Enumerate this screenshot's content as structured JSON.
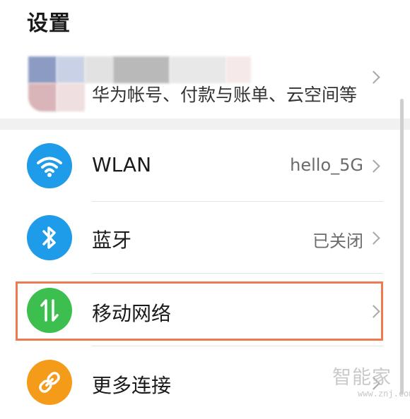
{
  "header": {
    "title": "设置"
  },
  "account": {
    "subtitle": "华为帐号、付款与账单、云空间等"
  },
  "settings": [
    {
      "label": "WLAN",
      "value": "hello_5G",
      "icon": "wifi-icon",
      "color": "#1e9be9"
    },
    {
      "label": "蓝牙",
      "value": "已关闭",
      "icon": "bluetooth-icon",
      "color": "#1e9be9"
    },
    {
      "label": "移动网络",
      "value": "",
      "icon": "mobile-data-icon",
      "color": "#3cbf4f"
    },
    {
      "label": "更多连接",
      "value": "",
      "icon": "link-icon",
      "color": "#f59b1a"
    }
  ],
  "highlight_color": "#ee7a52",
  "watermark": {
    "text": "智能家",
    "url": "www.znj.com"
  }
}
